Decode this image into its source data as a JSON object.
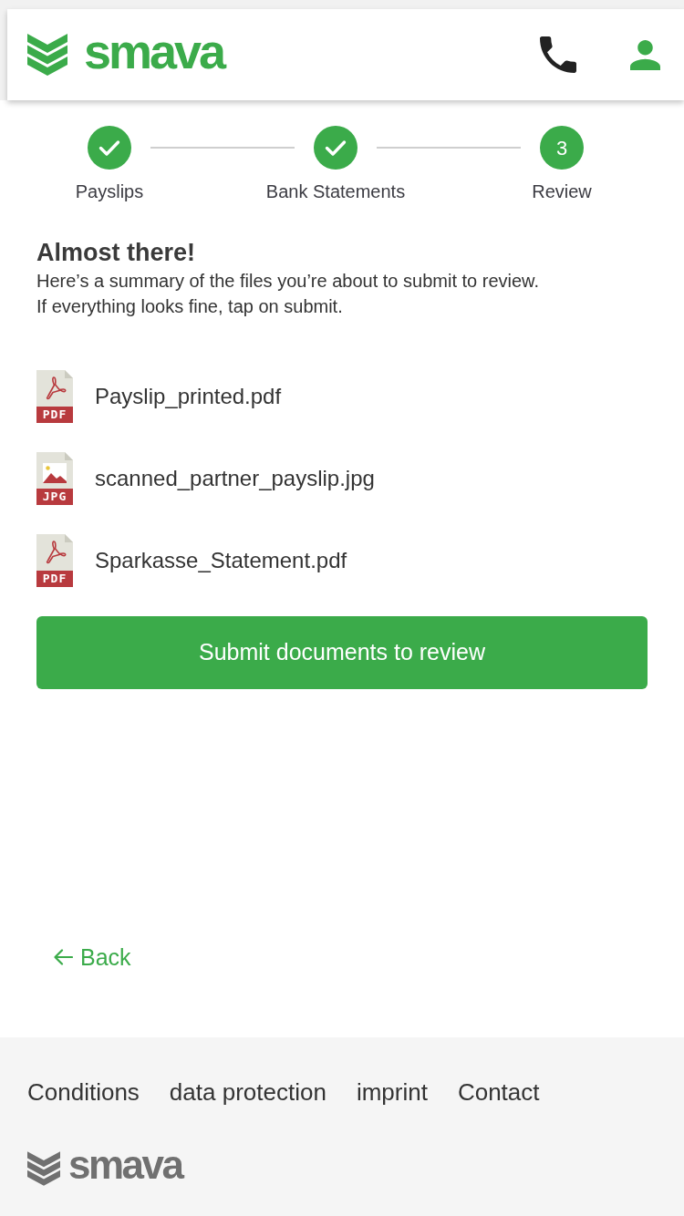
{
  "header": {
    "logo_text": "smava"
  },
  "steps": [
    {
      "label": "Payslips",
      "completed": true
    },
    {
      "label": "Bank Statements",
      "completed": true
    },
    {
      "label": "Review",
      "completed": false,
      "number": "3"
    }
  ],
  "intro": {
    "title": "Almost there!",
    "text": "Here’s a summary of the files you’re about to submit to review.\nIf everything looks fine, tap on submit."
  },
  "files": [
    {
      "name": "Payslip_printed.pdf",
      "kind": "pdf",
      "type_label": "PDF"
    },
    {
      "name": "scanned_partner_payslip.jpg",
      "kind": "image",
      "type_label": "JPG"
    },
    {
      "name": "Sparkasse_Statement.pdf",
      "kind": "pdf",
      "type_label": "PDF"
    }
  ],
  "submit_button": {
    "label": "Submit documents to review"
  },
  "back_link": {
    "label": "Back"
  },
  "footer": {
    "links": [
      "Conditions",
      "data protection",
      "imprint",
      "Contact"
    ],
    "logo_text": "smava"
  }
}
